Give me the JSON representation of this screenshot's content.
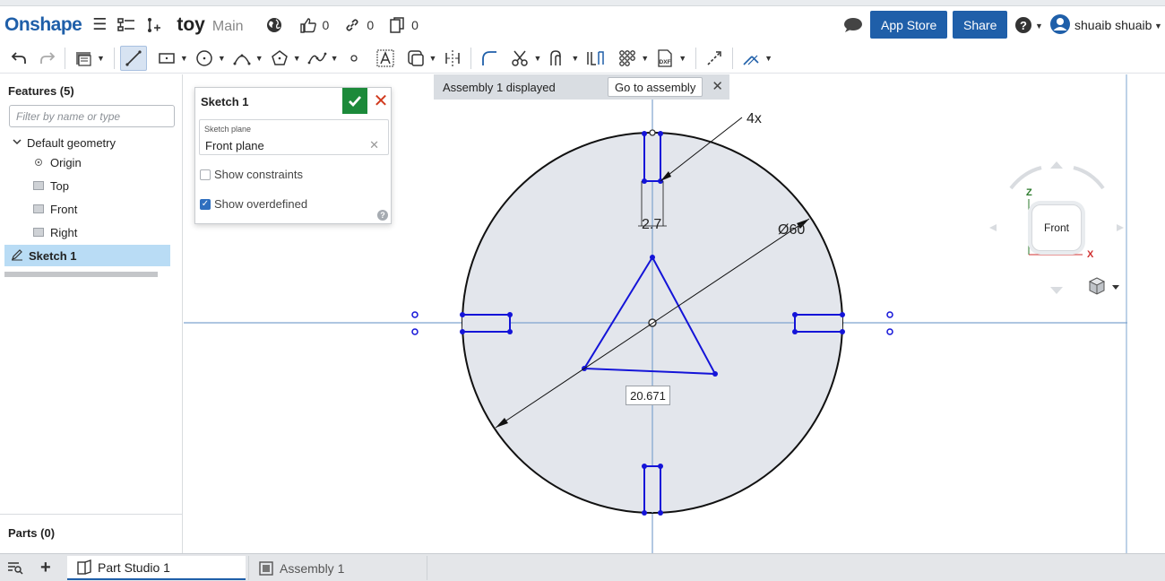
{
  "header": {
    "logo": "Onshape",
    "doc_title": "toy",
    "doc_branch": "Main",
    "likes": "0",
    "links": "0",
    "copies": "0",
    "app_store": "App Store",
    "share": "Share",
    "user": "shuaib shuaib"
  },
  "sidebar": {
    "features_header": "Features (5)",
    "filter_placeholder": "Filter by name or type",
    "default_geometry": "Default geometry",
    "items": [
      "Origin",
      "Top",
      "Front",
      "Right"
    ],
    "selected_item": "Sketch 1",
    "parts_header": "Parts (0)"
  },
  "dialog": {
    "title": "Sketch 1",
    "field_label": "Sketch plane",
    "field_value": "Front plane",
    "show_constraints": "Show constraints",
    "show_overdefined": "Show overdefined",
    "show_constraints_checked": false,
    "show_overdefined_checked": true
  },
  "assembly_bar": {
    "text": "Assembly 1 displayed",
    "button": "Go to assembly"
  },
  "sketch": {
    "dim_count": "4x",
    "dim_slot": "2.7",
    "dim_diameter": "Ø60",
    "dim_triangle": "20.671"
  },
  "viewcube": {
    "face": "Front",
    "axis_z": "Z",
    "axis_x": "X"
  },
  "tabs": {
    "part_studio": "Part Studio 1",
    "assembly": "Assembly 1"
  },
  "colors": {
    "brand": "#1f5fa9",
    "sketch_blue": "#1414d8",
    "ok_green": "#1c8a3a",
    "cancel_red": "#d13a1e"
  }
}
